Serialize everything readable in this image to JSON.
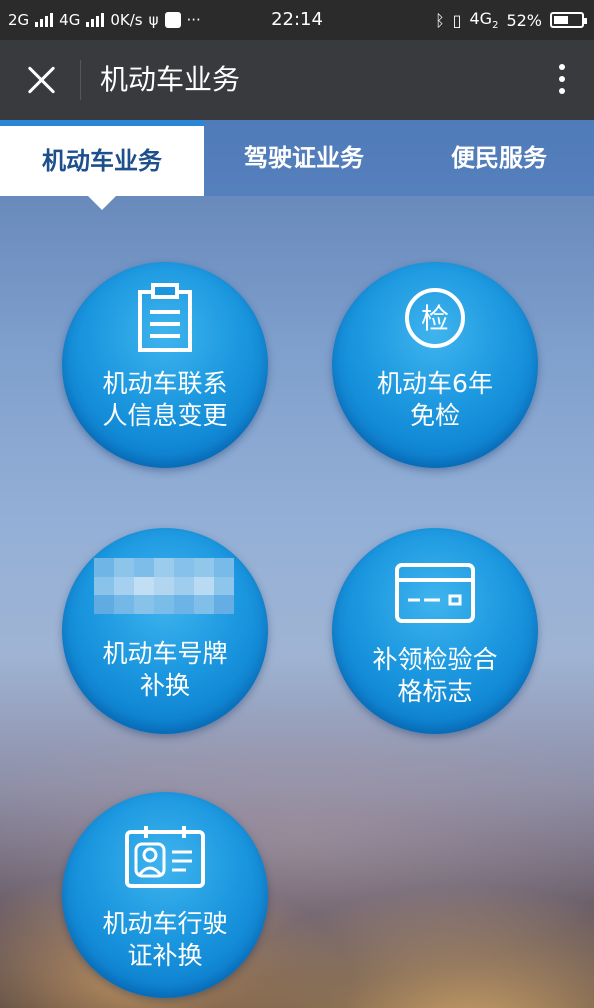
{
  "status_bar": {
    "net1": "2G",
    "net2": "4G",
    "speed": "0K/s",
    "more": "···",
    "time": "22:14",
    "net3": "4G",
    "net3_sub": "2",
    "battery": "52%",
    "battery_level": 0.52
  },
  "header": {
    "title": "机动车业务"
  },
  "tabs": [
    {
      "label": "机动车业务",
      "active": true
    },
    {
      "label": "驾驶证业务",
      "active": false
    },
    {
      "label": "便民服务",
      "active": false
    }
  ],
  "services": [
    {
      "label": "机动车联系\n人信息变更",
      "icon": "clipboard-icon"
    },
    {
      "label": "机动车6年\n免检",
      "icon": "inspection-seal-icon",
      "icon_text": "检"
    },
    {
      "label": "机动车号牌\n补换",
      "icon": "license-plate-pixelated-icon"
    },
    {
      "label": "补领检验合\n格标志",
      "icon": "card-icon"
    },
    {
      "label": "机动车行驶\n证补换",
      "icon": "id-card-icon"
    }
  ],
  "colors": {
    "tile": "#1b97df",
    "tab_active_text": "#1d4f8c",
    "header_bg": "#393a3e"
  }
}
